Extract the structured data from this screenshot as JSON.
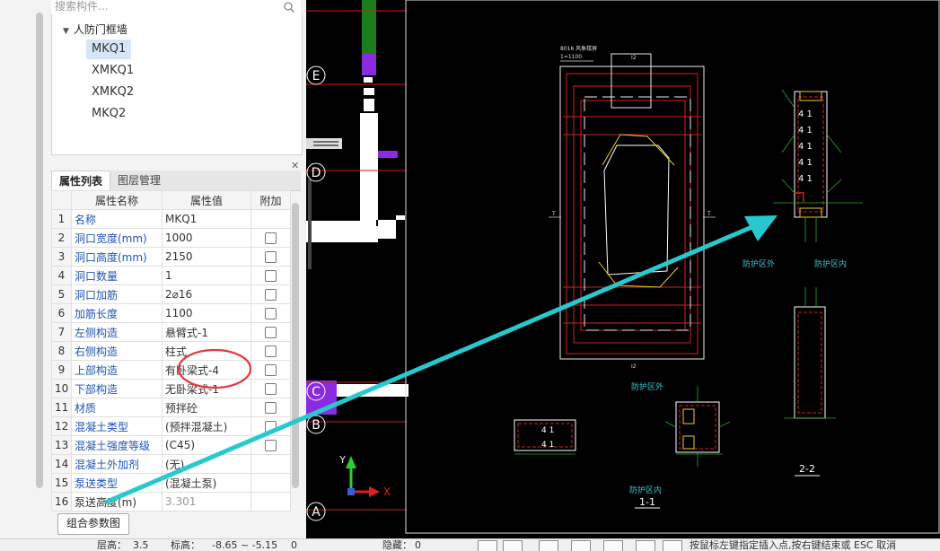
{
  "search": {
    "placeholder": "搜索构件..."
  },
  "tree": {
    "group": "人防门框墙",
    "items": [
      "MKQ1",
      "XMKQ1",
      "XMKQ2",
      "MKQ2"
    ],
    "selected": "MKQ1"
  },
  "tabs": [
    "属性列表",
    "图层管理"
  ],
  "table": {
    "headers": [
      "属性名称",
      "属性值",
      "附加"
    ],
    "rows": [
      {
        "n": "1",
        "name": "名称",
        "value": "MKQ1"
      },
      {
        "n": "2",
        "name": "洞口宽度(mm)",
        "value": "1000"
      },
      {
        "n": "3",
        "name": "洞口高度(mm)",
        "value": "2150"
      },
      {
        "n": "4",
        "name": "洞口数量",
        "value": "1"
      },
      {
        "n": "5",
        "name": "洞口加筋",
        "value": "2⌀16"
      },
      {
        "n": "6",
        "name": "加筋长度",
        "value": "1100"
      },
      {
        "n": "7",
        "name": "左侧构造",
        "value": "悬臂式-1"
      },
      {
        "n": "8",
        "name": "右侧构造",
        "value": "柱式"
      },
      {
        "n": "9",
        "name": "上部构造",
        "value": "有卧梁式-4"
      },
      {
        "n": "10",
        "name": "下部构造",
        "value": "无卧梁式-1"
      },
      {
        "n": "11",
        "name": "材质",
        "value": "预拌砼"
      },
      {
        "n": "12",
        "name": "混凝土类型",
        "value": "(预拌混凝土)"
      },
      {
        "n": "13",
        "name": "混凝土强度等级",
        "value": "(C45)"
      },
      {
        "n": "14",
        "name": "混凝土外加剂",
        "value": "(无)"
      },
      {
        "n": "15",
        "name": "泵送类型",
        "value": "(混凝土泵)"
      },
      {
        "n": "16",
        "name": "泵送高度(m)",
        "value": "3.301"
      }
    ]
  },
  "combo_button": "组合参数图",
  "axes": {
    "labels": [
      "E",
      "D",
      "C",
      "B",
      "A"
    ],
    "x": "X",
    "y": "Y"
  },
  "drawing": {
    "top_note": "8016 风象楼屏",
    "scale_note": "1=1100",
    "mark_i2": "I2",
    "mark_t": "T",
    "outside_label": "防护区外",
    "inside_label": "防护区内",
    "section_1": "1-1",
    "section_2": "2-2",
    "rebar_mark": "4  1"
  },
  "status": {
    "floor_label": "层高：",
    "floor_value": "3.5",
    "elev_label": "标高：",
    "elev_value": "-8.65 ~ -5.15",
    "extra_value": "0",
    "hidden_label": "隐藏：",
    "hidden_value": "0",
    "hint": "按鼠标左键指定插入点,按右键结束或 ESC 取消"
  },
  "colors": {
    "highlight": "#e8363d",
    "arrow": "#27c9cf",
    "canvas": "#000000",
    "link": "#1f55b8"
  }
}
